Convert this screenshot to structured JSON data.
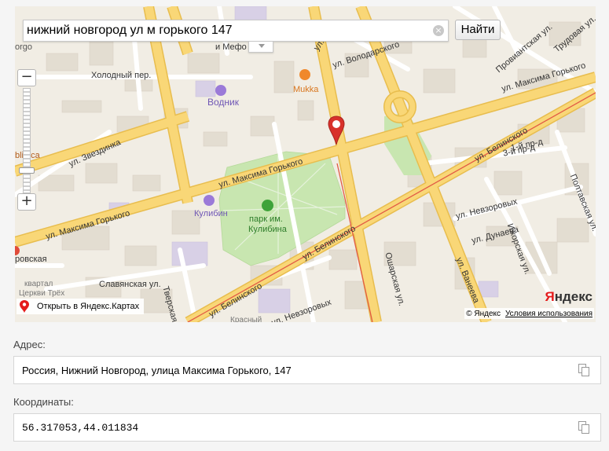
{
  "search": {
    "value": "нижний новгород ул м горького 147",
    "button_label": "Найти",
    "clear_glyph": "×"
  },
  "zoom": {
    "plus": "+",
    "minus": "−"
  },
  "map": {
    "open_link": "Открыть в Яндекс.Картах",
    "copyright": "© Яндекс",
    "terms": "Условия использования",
    "logo_first": "Я",
    "logo_rest": "ндекс",
    "labels": {
      "ul_gorkogo_1": "ул. Максима Горького",
      "ul_gorkogo_2": "ул. Максима Горького",
      "ul_gorkogo_3": "ул. Максима Горького",
      "ul_belinskogo_1": "ул. Белинского",
      "ul_belinskogo_2": "ул. Белинского",
      "ul_belinskogo_3": "ул. Белинского",
      "ul_zvezdinka": "ул. Звездинка",
      "holodny": "Холодный пер.",
      "slavyanskaya": "Славянская ул.",
      "oshar": "Ошарская ул.",
      "vaneeva": "ул. Ванеева",
      "nevzorov_1": "ул. Невзоровых",
      "nevzorov_2": "ул. Невзоровых",
      "dunaeva": "ул. Дунаева",
      "izhorskaya": "Ижорская ул.",
      "poltavskaya": "Полтавская ул.",
      "proviantskaya": "Провиантская ул.",
      "trudovaya": "Трудовая ул.",
      "tretiy": "3-й пр-д",
      "pervy": "1-й пр-д",
      "volodarskogo": "ул. Володарского",
      "akad": "ул. Акад",
      "tverskaya": "Тверская ул.",
      "vodnik": "Водник",
      "mukka": "Mukka",
      "kulibin": "Кулибин",
      "park": "парк им.",
      "park2": "Кулибина",
      "meфо": "и Мефо",
      "gorkovskaya": "ровская",
      "kvartal": "квартал",
      "tserkvi": "Церкви Трёх",
      "krasny": "Красный",
      "bibl": "bliteca",
      "gorgo": "orgo"
    }
  },
  "address": {
    "label": "Адрес:",
    "value": "Россия, Нижний Новгород, улица Максима Горького, 147"
  },
  "coords": {
    "label": "Координаты:",
    "value": "56.317053,44.011834"
  },
  "colors": {
    "main_road": "#f9d777",
    "main_road_edge": "#e8bd4e",
    "park": "#c8e6b0",
    "building": "#e3ddd1",
    "building_purple": "#d8d0e6",
    "marker": "#d8312b",
    "tram": "#e25b45"
  }
}
